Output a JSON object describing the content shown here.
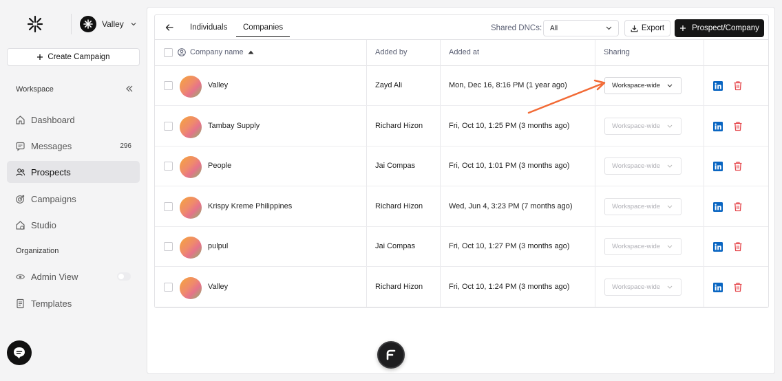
{
  "workspace": {
    "name": "Valley"
  },
  "sidebar": {
    "create_label": "Create Campaign",
    "section_workspace": "Workspace",
    "section_org": "Organization",
    "items": [
      {
        "label": "Dashboard",
        "icon": "home-icon"
      },
      {
        "label": "Messages",
        "icon": "message-icon",
        "count": "296"
      },
      {
        "label": "Prospects",
        "icon": "users-icon"
      },
      {
        "label": "Campaigns",
        "icon": "target-icon"
      },
      {
        "label": "Studio",
        "icon": "studio-icon"
      }
    ],
    "org_items": [
      {
        "label": "Admin View",
        "icon": "eye-icon"
      },
      {
        "label": "Templates",
        "icon": "document-icon"
      }
    ]
  },
  "toolbar": {
    "tabs": [
      "Individuals",
      "Companies"
    ],
    "active_tab": "Companies",
    "dnc_label": "Shared DNCs:",
    "dnc_value": "All",
    "export_label": "Export",
    "prospect_label": "Prospect/Company"
  },
  "table": {
    "headers": [
      "Company name",
      "Added by",
      "Added at",
      "Sharing"
    ],
    "rows": [
      {
        "name": "Valley",
        "added_by": "Zayd Ali",
        "added_at": "Mon, Dec 16, 8:16 PM (1 year ago)",
        "sharing": "Workspace-wide"
      },
      {
        "name": "Tambay Supply",
        "added_by": "Richard Hizon",
        "added_at": "Fri, Oct 10, 1:25 PM (3 months ago)",
        "sharing": "Workspace-wide"
      },
      {
        "name": "People",
        "added_by": "Jai Compas",
        "added_at": "Fri, Oct 10, 1:01 PM (3 months ago)",
        "sharing": "Workspace-wide"
      },
      {
        "name": "Krispy Kreme Philippines",
        "added_by": "Richard Hizon",
        "added_at": "Wed, Jun 4, 3:23 PM (7 months ago)",
        "sharing": "Workspace-wide"
      },
      {
        "name": "pulpul",
        "added_by": "Jai Compas",
        "added_at": "Fri, Oct 10, 1:27 PM (3 months ago)",
        "sharing": "Workspace-wide"
      },
      {
        "name": "Valley",
        "added_by": "Richard Hizon",
        "added_at": "Fri, Oct 10, 1:24 PM (3 months ago)",
        "sharing": "Workspace-wide"
      }
    ]
  },
  "colors": {
    "linkedin": "#0a66c2",
    "delete": "#e5484d",
    "annotation_arrow": "#f26a35"
  }
}
